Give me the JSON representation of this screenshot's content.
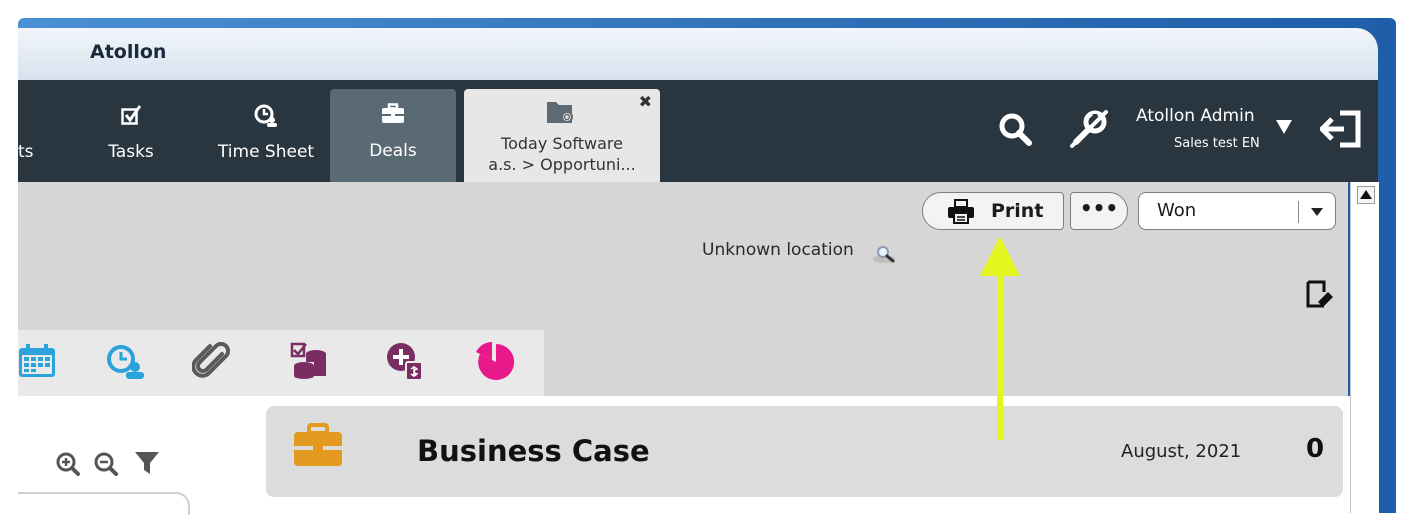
{
  "app": {
    "title": "Atollon"
  },
  "nav": {
    "items": [
      {
        "label": "ts",
        "icon": "partial-nav-icon"
      },
      {
        "label": "Tasks",
        "icon": "checkbox-icon"
      },
      {
        "label": "Time Sheet",
        "icon": "clock-user-icon"
      },
      {
        "label": "Deals",
        "icon": "briefcase-icon",
        "active": true
      }
    ],
    "open_tab": {
      "line1": "Today Software",
      "line2": "a.s. > Opportuni...",
      "icon": "folder-search-icon",
      "close": "✖"
    }
  },
  "user": {
    "name": "Atollon Admin",
    "subtitle": "Sales test EN"
  },
  "toolbar": {
    "print_label": "Print",
    "more_label": "•••",
    "status_value": "Won"
  },
  "location": {
    "text": "Unknown location"
  },
  "record_tabs": [
    {
      "icon": "calendar-icon",
      "color": "#2aa3dc"
    },
    {
      "icon": "time-entry-icon",
      "color": "#2aa3dc"
    },
    {
      "icon": "attachment-icon",
      "color": "#555555"
    },
    {
      "icon": "budget-icon",
      "color": "#7a2d63"
    },
    {
      "icon": "add-expense-icon",
      "color": "#7a2d63"
    },
    {
      "icon": "pie-chart-icon",
      "color": "#e8198b"
    }
  ],
  "case": {
    "title": "Business Case",
    "date": "August, 2021",
    "count": "0",
    "icon_color": "#e39a1e"
  },
  "colors": {
    "navbar": "#29353f",
    "active_tab": "#5a6a75",
    "annotation_arrow": "#e4f51f"
  }
}
